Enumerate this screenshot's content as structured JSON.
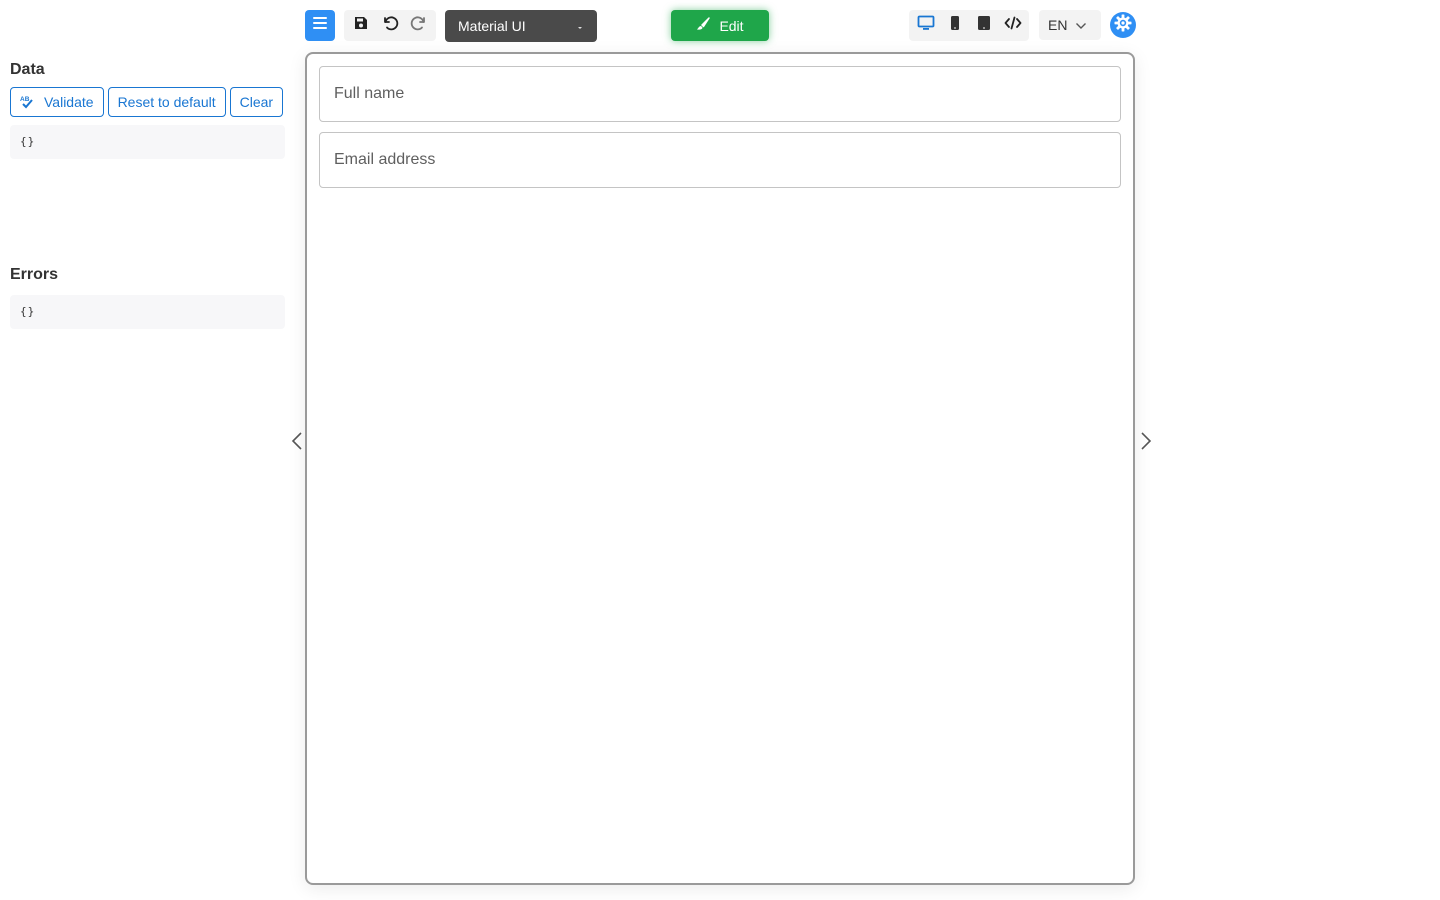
{
  "data_panel": {
    "title": "Data",
    "buttons": {
      "validate": "Validate",
      "reset": "Reset to default",
      "clear": "Clear"
    },
    "value": "{}"
  },
  "errors_panel": {
    "title": "Errors",
    "value": "{}"
  },
  "toolbar": {
    "menu_icon": "menu-icon",
    "tools": [
      "save-icon",
      "undo-icon",
      "redo-icon"
    ],
    "theme_select": {
      "selected": "Material UI"
    },
    "edit_label": "Edit",
    "devices": [
      "desktop-icon",
      "mobile-icon",
      "tablet-icon",
      "code-icon"
    ],
    "language": "EN",
    "settings_icon": "gear-icon"
  },
  "form": {
    "fields": [
      {
        "placeholder": "Full name"
      },
      {
        "placeholder": "Email address"
      }
    ]
  },
  "colors": {
    "accent_blue": "#2f8ff4",
    "outline_blue": "#1976d2",
    "edit_green": "#1fa64a",
    "theme_select_bg": "#4a4a4a"
  }
}
